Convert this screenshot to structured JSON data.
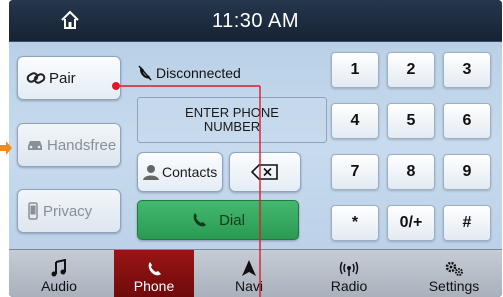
{
  "header": {
    "clock": "11:30 AM"
  },
  "side_buttons": {
    "pair": "Pair",
    "handsfree": "Handsfree",
    "privacy": "Privacy"
  },
  "phone": {
    "status": "Disconnected",
    "input_placeholder": "ENTER PHONE\nNUMBER",
    "contacts_label": "Contacts",
    "dial_label": "Dial"
  },
  "keypad": [
    "1",
    "2",
    "3",
    "4",
    "5",
    "6",
    "7",
    "8",
    "9",
    "*",
    "0/+",
    "#"
  ],
  "nav": {
    "items": [
      {
        "label": "Audio",
        "icon": "music-note-icon"
      },
      {
        "label": "Phone",
        "icon": "phone-icon",
        "active": true
      },
      {
        "label": "Navi",
        "icon": "navigation-arrow-icon"
      },
      {
        "label": "Radio",
        "icon": "radio-broadcast-icon"
      },
      {
        "label": "Settings",
        "icon": "gears-icon"
      }
    ]
  },
  "colors": {
    "active_tab": "#8b1010",
    "dial_green": "#34a85e",
    "annotation": "#e0192a",
    "arrow": "#f08a1e"
  }
}
